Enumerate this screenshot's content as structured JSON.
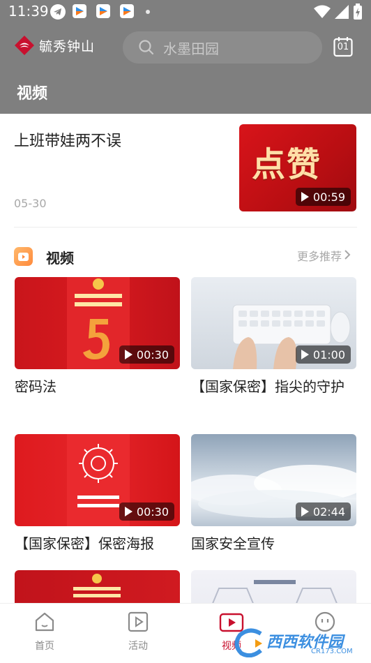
{
  "status_bar": {
    "time": "11:39"
  },
  "header": {
    "app_name": "毓秀钟山",
    "search_placeholder": "水墨田园",
    "calendar_day": "01",
    "page_title": "视频"
  },
  "featured": {
    "title": "上班带娃两不误",
    "date": "05-30",
    "thumb_text": "点赞",
    "duration": "00:59"
  },
  "section": {
    "title": "视频",
    "more_label": "更多推荐"
  },
  "videos": [
    {
      "title": "密码法",
      "duration": "00:30"
    },
    {
      "title": "【国家保密】指尖的守护",
      "duration": "01:00"
    },
    {
      "title": "【国家保密】保密海报",
      "duration": "00:30"
    },
    {
      "title": "国家安全宣传",
      "duration": "02:44"
    }
  ],
  "bottom_nav": {
    "items": [
      {
        "label": "首页",
        "icon": "home-icon"
      },
      {
        "label": "活动",
        "icon": "play-square-icon"
      },
      {
        "label": "视频",
        "icon": "video-icon",
        "active": true
      },
      {
        "label": "",
        "icon": "smiley-icon"
      }
    ]
  },
  "colors": {
    "header_overlay": "#7f7f7f",
    "accent_red": "#c8102e",
    "muted_text": "#a8a8a8"
  },
  "watermark": {
    "text": "西西软件园",
    "sub": "CR173.COM"
  }
}
